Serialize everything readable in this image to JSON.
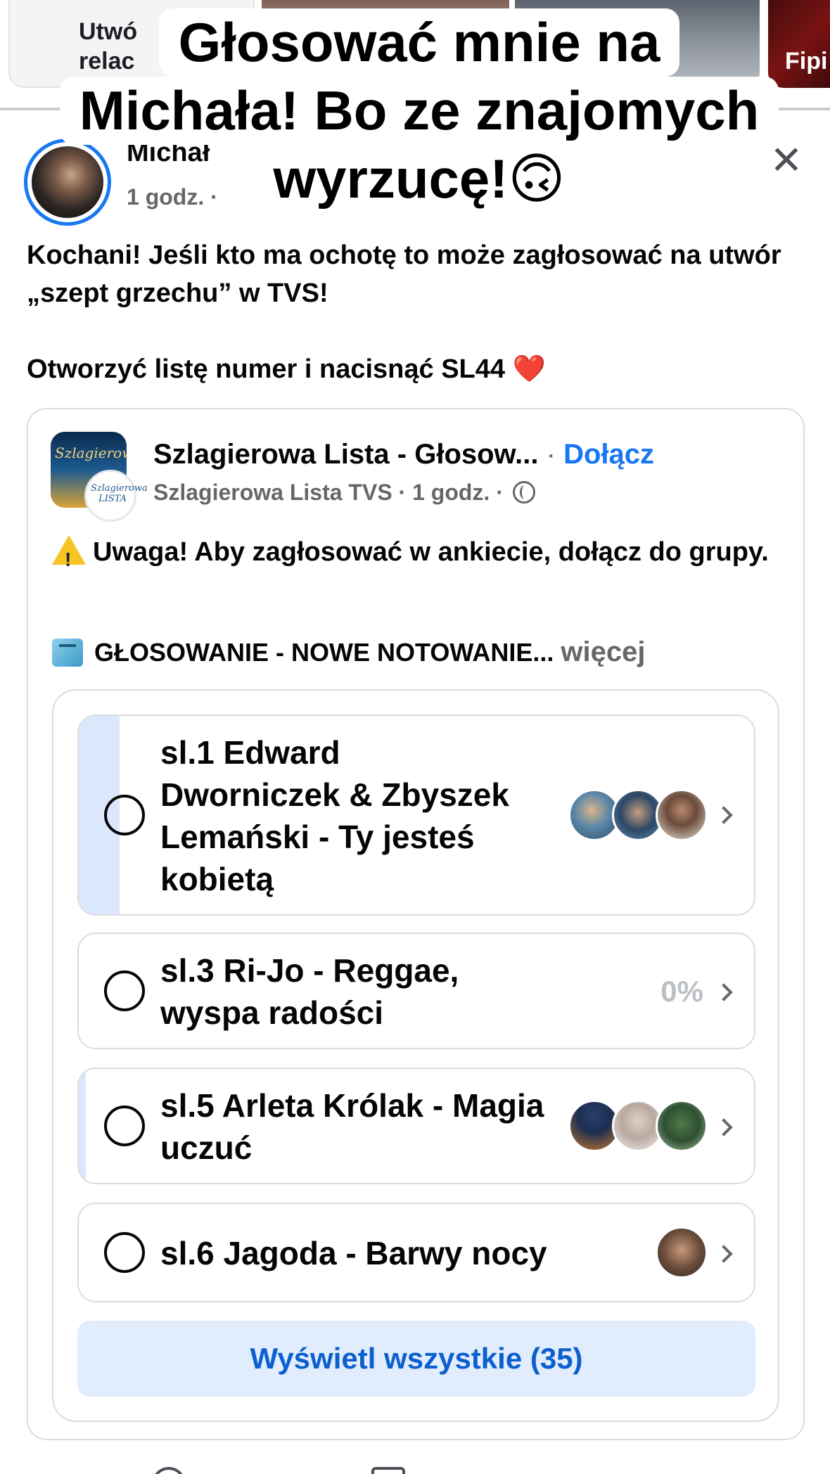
{
  "stories": {
    "create_text_line1": "Utwó",
    "create_text_line2": "relac",
    "last_story_name": "Fipi"
  },
  "caption": {
    "line1": "Głosować mnie na",
    "line2": "Michała! Bo ze znajomych",
    "line3": "wyrzucę!🙃"
  },
  "post": {
    "author_name": "Michał",
    "time": "1 godz. ·",
    "text_paragraph1": "Kochani! Jeśli kto ma ochotę to może zagłosować na utwór „szept grzechu” w TVS!",
    "text_paragraph2": "Otworzyć listę numer i nacisnąć SL44 ❤️"
  },
  "shared": {
    "avatar_title": "Szlagierowa",
    "avatar_sub": "Szlagierowa LISTA",
    "group_title": "Szlagierowa Lista - Głosow...",
    "separator": " · ",
    "join_label": "Dołącz",
    "meta": "Szlagierowa Lista TVS · 1 godz. ·",
    "warning": "Uwaga! Aby zagłosować w ankiecie, dołącz do grupy.",
    "voting_text": "GŁOSOWANIE - NOWE NOTOWANIE...",
    "more_label": "więcej"
  },
  "poll": {
    "options": [
      {
        "label": "sl.1 Edward Dworniczek & Zbyszek Lemański - Ty jesteś kobietą",
        "fill_fraction": 0.06,
        "percent": "",
        "voters": 3
      },
      {
        "label": "sl.3 Ri-Jo - Reggae, wyspa radości",
        "fill_fraction": 0.0,
        "percent": "0%",
        "voters": 0
      },
      {
        "label": "sl.5 Arleta Królak - Magia uczuć",
        "fill_fraction": 0.01,
        "percent": "",
        "voters": 3
      },
      {
        "label": "sl.6 Jagoda - Barwy nocy",
        "fill_fraction": 0.0,
        "percent": "",
        "voters": 1
      }
    ],
    "view_all_label": "Wyświetl wszystkie (35)"
  },
  "colors": {
    "accent": "#1877f2",
    "poll_fill": "#dbe7fb",
    "view_all_bg": "#e1edfd",
    "view_all_text": "#0b5fcf",
    "secondary_text": "#65676b"
  },
  "icons": {
    "close": "close-icon",
    "globe": "globe-icon",
    "warning": "warning-icon",
    "ballot": "ballot-box-icon",
    "chevron": "chevron-right-icon",
    "heart": "red-heart-emoji"
  }
}
